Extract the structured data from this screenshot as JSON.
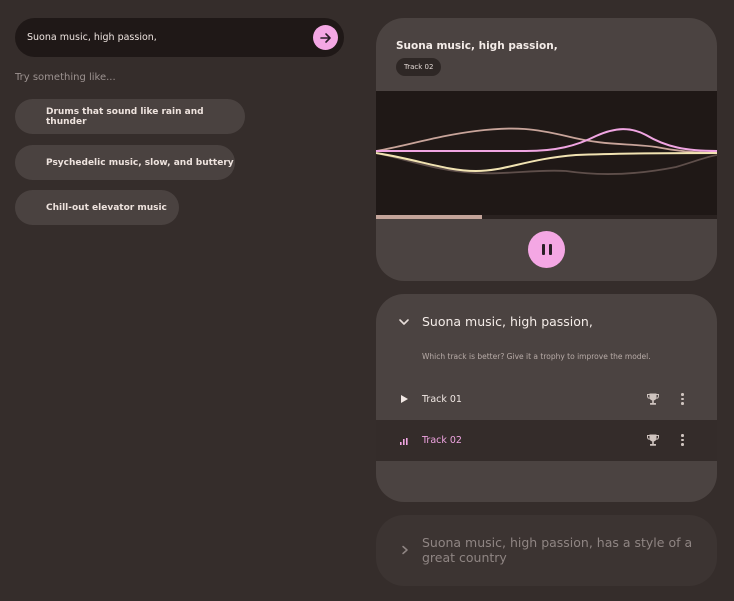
{
  "prompt": {
    "value": "Suona music, high passion,",
    "submit_icon": "arrow-right-icon",
    "accent": "#f4a7e4"
  },
  "suggestions": {
    "label": "Try something like...",
    "items": [
      "Drums that sound like rain and thunder",
      "Psychedelic music, slow, and buttery",
      "Chill-out elevator music"
    ]
  },
  "player": {
    "title": "Suona music, high passion,",
    "track_badge": "Track 02",
    "progress": 0.31,
    "pause_icon": "pause-icon"
  },
  "session": {
    "title": "Suona music, high passion,",
    "hint": "Which track is better? Give it a trophy to improve the model.",
    "tracks": [
      {
        "name": "Track 01",
        "state": "paused",
        "icon": "play-icon"
      },
      {
        "name": "Track 02",
        "state": "playing",
        "icon": "equalizer-icon"
      }
    ]
  },
  "collapsed": {
    "title": "Suona music, high passion, has a style of a great country"
  }
}
